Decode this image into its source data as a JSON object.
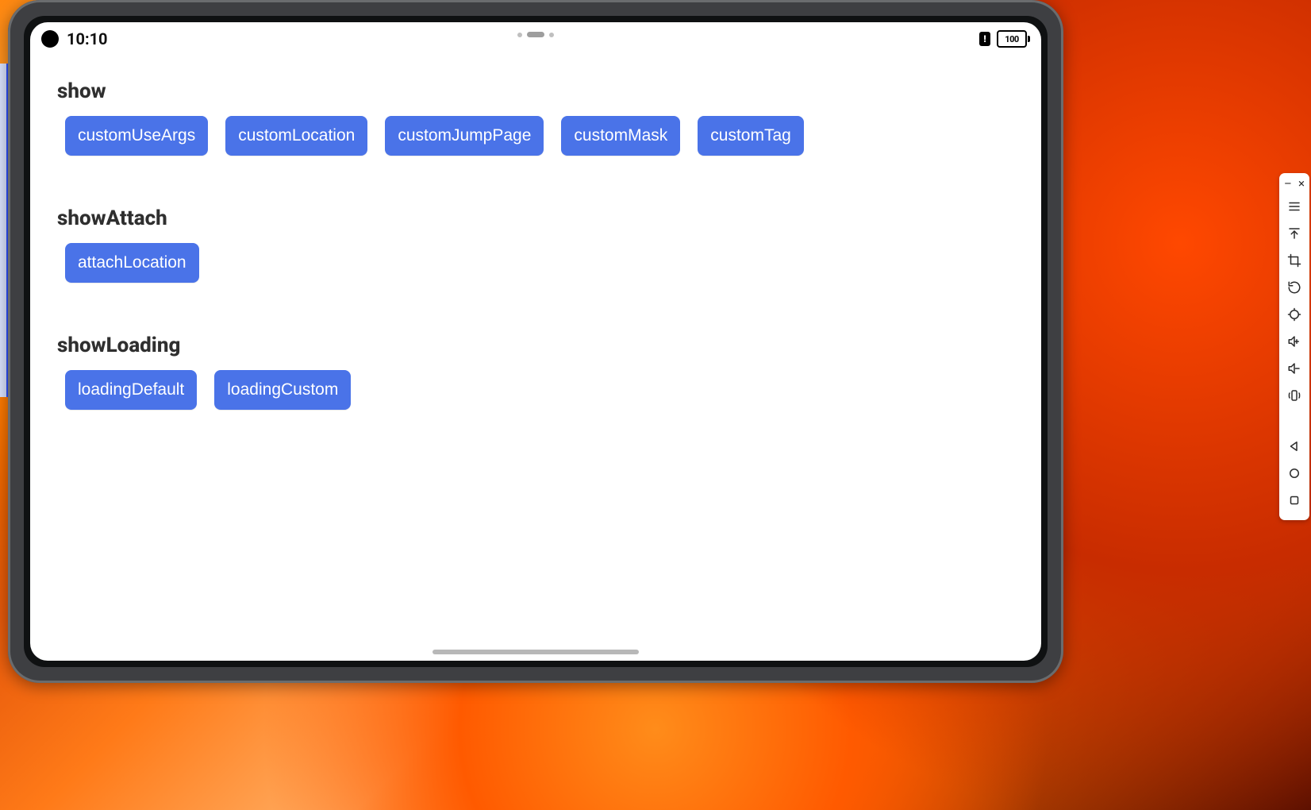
{
  "statusbar": {
    "time": "10:10",
    "battery_pct": "100"
  },
  "sections": [
    {
      "title": "show",
      "buttons": [
        "customUseArgs",
        "customLocation",
        "customJumpPage",
        "customMask",
        "customTag"
      ]
    },
    {
      "title": "showAttach",
      "buttons": [
        "attachLocation"
      ]
    },
    {
      "title": "showLoading",
      "buttons": [
        "loadingDefault",
        "loadingCustom"
      ]
    }
  ],
  "emulator_tools": {
    "minimize": "–",
    "close": "×"
  }
}
